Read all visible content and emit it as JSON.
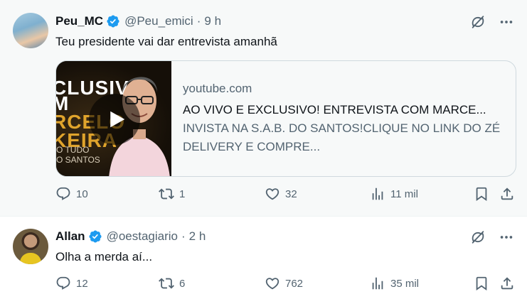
{
  "colors": {
    "verified_blue": "#1d9bf0",
    "text_primary": "#0f1419",
    "text_secondary": "#536471"
  },
  "tweets": [
    {
      "name": "Peu_MC",
      "handle": "@Peu_emici",
      "dot": "·",
      "time": "9 h",
      "text": "Teu presidente vai dar entrevista amanhã",
      "card": {
        "thumbnail_text": [
          "CLUSIVA",
          "M",
          "RCELO",
          "KEIRA",
          "O TUDO",
          "O SANTOS"
        ],
        "domain": "youtube.com",
        "title": "AO VIVO E EXCLUSIVO! ENTREVISTA COM MARCE...",
        "description": "INVISTA NA S.A.B. DO SANTOS!CLIQUE NO LINK DO ZÉ DELIVERY E COMPRE..."
      },
      "actions": {
        "replies": "10",
        "retweets": "1",
        "likes": "32",
        "views": "11 mil"
      }
    },
    {
      "name": "Allan",
      "handle": "@oestagiario",
      "dot": "·",
      "time": "2 h",
      "text": "Olha a merda aí...",
      "actions": {
        "replies": "12",
        "retweets": "6",
        "likes": "762",
        "views": "35 mil"
      }
    }
  ],
  "icons": {
    "verified": "verified-badge-icon",
    "grok": "grok-icon",
    "more": "more-icon",
    "reply": "reply-icon",
    "retweet": "retweet-icon",
    "like": "heart-icon",
    "views": "views-icon",
    "bookmark": "bookmark-icon",
    "share": "share-icon",
    "play": "play-icon"
  }
}
